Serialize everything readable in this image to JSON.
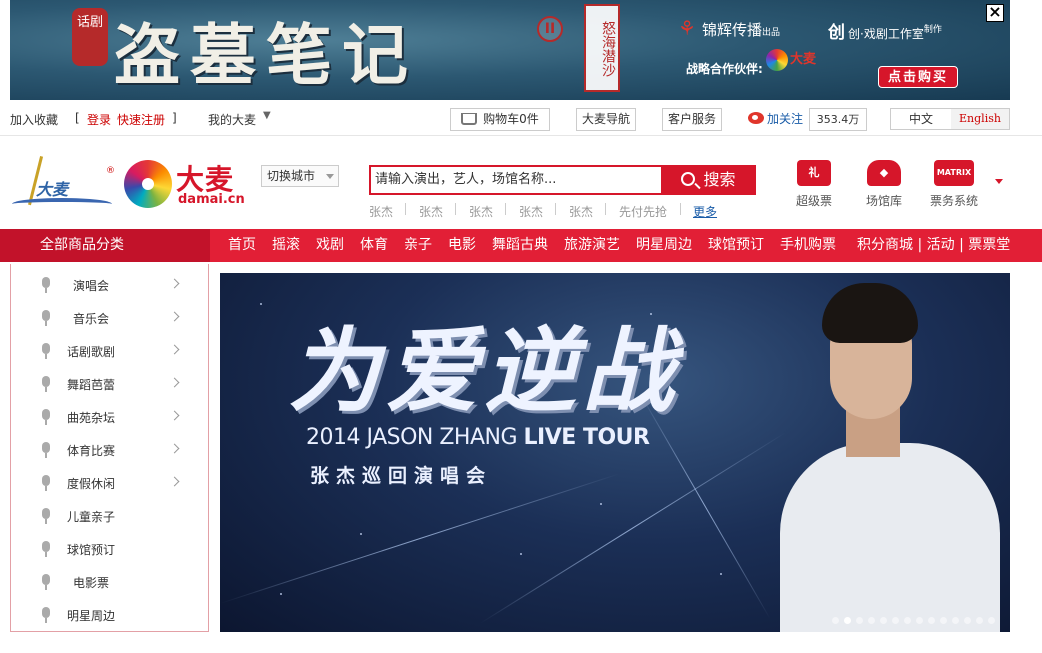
{
  "ad": {
    "seal": "话剧",
    "title": "盗墓笔记",
    "roman": "II",
    "vertical": "怒海潜沙",
    "sponsor1": "锦辉传播",
    "sponsor1_note": "出品",
    "sponsor2_mark": "创",
    "sponsor2": "创·戏剧工作室",
    "sponsor2_note": "制作",
    "partner_label": "战略合作伙伴:",
    "partner_name": "大麦",
    "buy_label": "点击购买",
    "close_label": "×"
  },
  "toolbar": {
    "favorite": "加入收藏",
    "bracket_open": "[",
    "login": "登录",
    "register": "快速注册",
    "bracket_close": "]",
    "my_damai": "我的大麦",
    "cart": "购物车0件",
    "nav_guide": "大麦导航",
    "service": "客户服务",
    "follow": "加关注",
    "followers": "353.4万",
    "lang_cn": "中文",
    "lang_en": "English"
  },
  "header": {
    "logo_wheat": "大麦",
    "logo_damai_cn": "大麦",
    "logo_damai_en": "damai.cn",
    "city_label": "切换城市",
    "search_placeholder": "请输入演出，艺人，场馆名称...",
    "search_button": "搜索",
    "hot_keywords": [
      "张杰",
      "张杰",
      "张杰",
      "张杰",
      "张杰",
      "先付先抢"
    ],
    "more": "更多",
    "icons": [
      {
        "label": "超级票",
        "icon": "ticket-icon",
        "glyph": "礼",
        "color": "#d6162a"
      },
      {
        "label": "场馆库",
        "icon": "venue-icon",
        "glyph": "◆",
        "color": "#d6162a"
      },
      {
        "label": "票务系统",
        "icon": "matrix-icon",
        "glyph": "MATRIX",
        "color": "#d6162a"
      }
    ]
  },
  "nav": {
    "all_categories": "全部商品分类",
    "items": [
      "首页",
      "摇滚",
      "戏剧",
      "体育",
      "亲子",
      "电影",
      "舞蹈古典",
      "旅游演艺",
      "明星周边",
      "球馆预订",
      "手机购票",
      "积分商城 | 活动 | 票票堂"
    ]
  },
  "sidebar": {
    "items": [
      {
        "label": "演唱会",
        "arrow": true
      },
      {
        "label": "音乐会",
        "arrow": true
      },
      {
        "label": "话剧歌剧",
        "arrow": true
      },
      {
        "label": "舞蹈芭蕾",
        "arrow": true
      },
      {
        "label": "曲苑杂坛",
        "arrow": true
      },
      {
        "label": "体育比赛",
        "arrow": true
      },
      {
        "label": "度假休闲",
        "arrow": true
      },
      {
        "label": "儿童亲子",
        "arrow": false
      },
      {
        "label": "球馆预订",
        "arrow": false
      },
      {
        "label": "电影票",
        "arrow": false
      },
      {
        "label": "明星周边",
        "arrow": false
      }
    ]
  },
  "hero": {
    "title_cn": "为爱逆战",
    "tour_prefix": "2014 JASON ZHANG ",
    "tour_bold": "LIVE TOUR",
    "tour_cn": "张杰巡回演唱会",
    "slide_count": 14,
    "active_slide": 1
  },
  "colors": {
    "brand_red": "#e21f36",
    "dark_red": "#c2122a",
    "link_blue": "#1a5ca8"
  }
}
